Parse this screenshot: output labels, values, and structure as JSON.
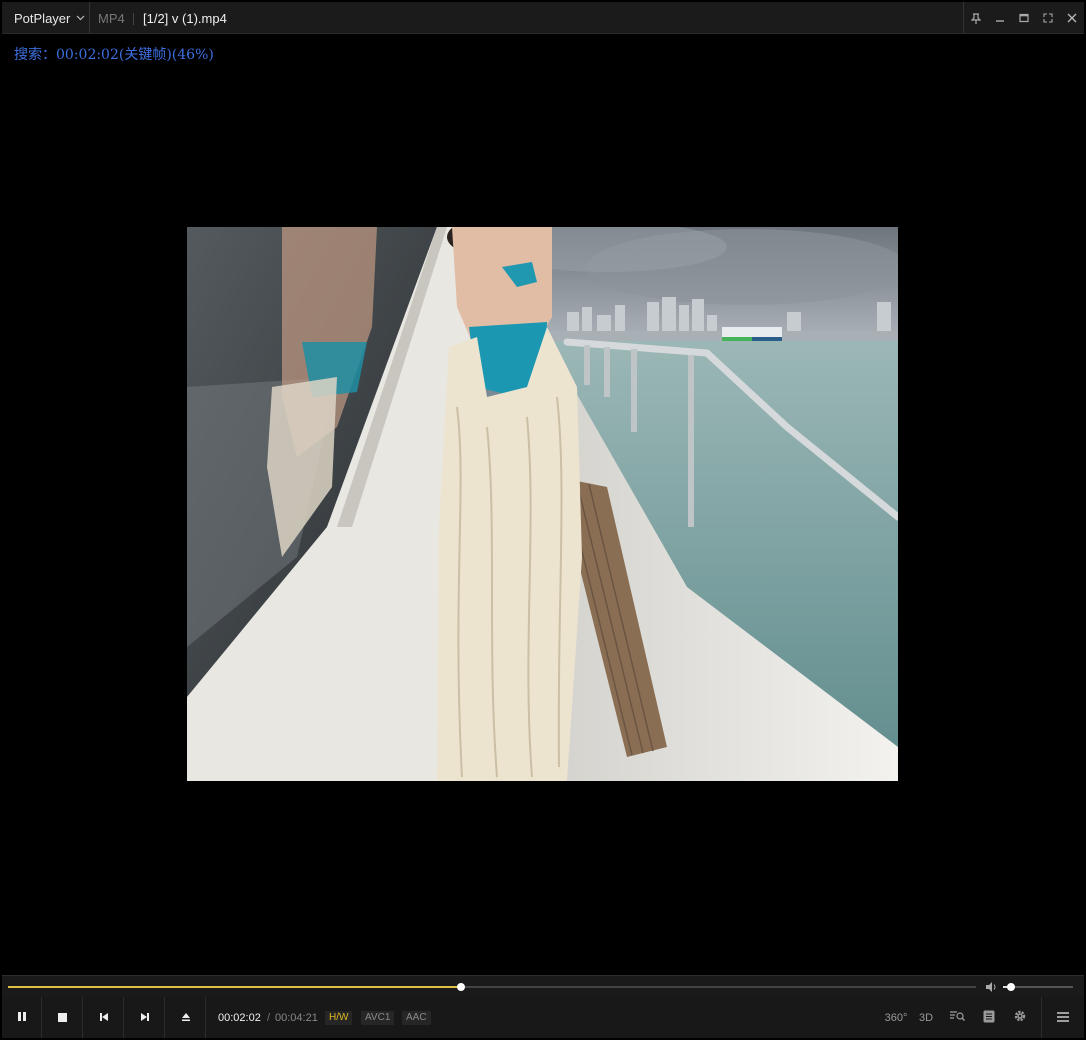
{
  "titlebar": {
    "app_name": "PotPlayer",
    "format": "MP4",
    "filename": "[1/2] v (1).mp4"
  },
  "osd": {
    "text": "搜索：00:02:02(关键帧)(46%)"
  },
  "playback": {
    "current_time": "00:02:02",
    "separator": "/",
    "total_time": "00:04:21",
    "progress_fraction": 0.468,
    "volume_fraction": 0.12
  },
  "badges": {
    "hw": "H/W",
    "video_codec": "AVC1",
    "audio_codec": "AAC"
  },
  "right_controls": {
    "vr": "360°",
    "three_d": "3D"
  },
  "colors": {
    "seek_fill": "#e0c040",
    "osd_text": "#3d6fe0",
    "hw_badge": "#e0b820"
  },
  "icons": {
    "app_menu": "chevron-down-icon",
    "pin": "pin-icon",
    "minimize": "minimize-icon",
    "maximize": "maximize-icon",
    "fullscreen": "fullscreen-icon",
    "close": "close-icon",
    "play_pause": "pause-icon",
    "stop": "stop-icon",
    "prev": "previous-icon",
    "next": "next-icon",
    "open": "eject-icon",
    "volume": "volume-icon",
    "vr": "360-icon",
    "three_d": "3d-icon",
    "playlist_search": "playlist-search-icon",
    "chapter": "chapter-icon",
    "settings": "gear-icon",
    "menu": "hamburger-menu-icon"
  }
}
